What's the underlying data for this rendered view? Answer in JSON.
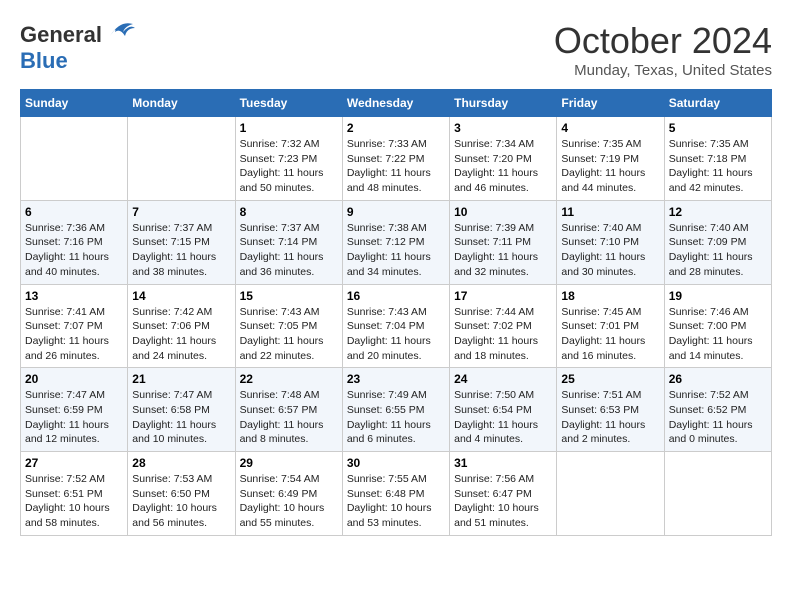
{
  "header": {
    "logo_text_general": "General",
    "logo_text_blue": "Blue",
    "month_title": "October 2024",
    "location": "Munday, Texas, United States"
  },
  "days_of_week": [
    "Sunday",
    "Monday",
    "Tuesday",
    "Wednesday",
    "Thursday",
    "Friday",
    "Saturday"
  ],
  "weeks": [
    [
      {
        "day": "",
        "content": ""
      },
      {
        "day": "",
        "content": ""
      },
      {
        "day": "1",
        "content": "Sunrise: 7:32 AM\nSunset: 7:23 PM\nDaylight: 11 hours and 50 minutes."
      },
      {
        "day": "2",
        "content": "Sunrise: 7:33 AM\nSunset: 7:22 PM\nDaylight: 11 hours and 48 minutes."
      },
      {
        "day": "3",
        "content": "Sunrise: 7:34 AM\nSunset: 7:20 PM\nDaylight: 11 hours and 46 minutes."
      },
      {
        "day": "4",
        "content": "Sunrise: 7:35 AM\nSunset: 7:19 PM\nDaylight: 11 hours and 44 minutes."
      },
      {
        "day": "5",
        "content": "Sunrise: 7:35 AM\nSunset: 7:18 PM\nDaylight: 11 hours and 42 minutes."
      }
    ],
    [
      {
        "day": "6",
        "content": "Sunrise: 7:36 AM\nSunset: 7:16 PM\nDaylight: 11 hours and 40 minutes."
      },
      {
        "day": "7",
        "content": "Sunrise: 7:37 AM\nSunset: 7:15 PM\nDaylight: 11 hours and 38 minutes."
      },
      {
        "day": "8",
        "content": "Sunrise: 7:37 AM\nSunset: 7:14 PM\nDaylight: 11 hours and 36 minutes."
      },
      {
        "day": "9",
        "content": "Sunrise: 7:38 AM\nSunset: 7:12 PM\nDaylight: 11 hours and 34 minutes."
      },
      {
        "day": "10",
        "content": "Sunrise: 7:39 AM\nSunset: 7:11 PM\nDaylight: 11 hours and 32 minutes."
      },
      {
        "day": "11",
        "content": "Sunrise: 7:40 AM\nSunset: 7:10 PM\nDaylight: 11 hours and 30 minutes."
      },
      {
        "day": "12",
        "content": "Sunrise: 7:40 AM\nSunset: 7:09 PM\nDaylight: 11 hours and 28 minutes."
      }
    ],
    [
      {
        "day": "13",
        "content": "Sunrise: 7:41 AM\nSunset: 7:07 PM\nDaylight: 11 hours and 26 minutes."
      },
      {
        "day": "14",
        "content": "Sunrise: 7:42 AM\nSunset: 7:06 PM\nDaylight: 11 hours and 24 minutes."
      },
      {
        "day": "15",
        "content": "Sunrise: 7:43 AM\nSunset: 7:05 PM\nDaylight: 11 hours and 22 minutes."
      },
      {
        "day": "16",
        "content": "Sunrise: 7:43 AM\nSunset: 7:04 PM\nDaylight: 11 hours and 20 minutes."
      },
      {
        "day": "17",
        "content": "Sunrise: 7:44 AM\nSunset: 7:02 PM\nDaylight: 11 hours and 18 minutes."
      },
      {
        "day": "18",
        "content": "Sunrise: 7:45 AM\nSunset: 7:01 PM\nDaylight: 11 hours and 16 minutes."
      },
      {
        "day": "19",
        "content": "Sunrise: 7:46 AM\nSunset: 7:00 PM\nDaylight: 11 hours and 14 minutes."
      }
    ],
    [
      {
        "day": "20",
        "content": "Sunrise: 7:47 AM\nSunset: 6:59 PM\nDaylight: 11 hours and 12 minutes."
      },
      {
        "day": "21",
        "content": "Sunrise: 7:47 AM\nSunset: 6:58 PM\nDaylight: 11 hours and 10 minutes."
      },
      {
        "day": "22",
        "content": "Sunrise: 7:48 AM\nSunset: 6:57 PM\nDaylight: 11 hours and 8 minutes."
      },
      {
        "day": "23",
        "content": "Sunrise: 7:49 AM\nSunset: 6:55 PM\nDaylight: 11 hours and 6 minutes."
      },
      {
        "day": "24",
        "content": "Sunrise: 7:50 AM\nSunset: 6:54 PM\nDaylight: 11 hours and 4 minutes."
      },
      {
        "day": "25",
        "content": "Sunrise: 7:51 AM\nSunset: 6:53 PM\nDaylight: 11 hours and 2 minutes."
      },
      {
        "day": "26",
        "content": "Sunrise: 7:52 AM\nSunset: 6:52 PM\nDaylight: 11 hours and 0 minutes."
      }
    ],
    [
      {
        "day": "27",
        "content": "Sunrise: 7:52 AM\nSunset: 6:51 PM\nDaylight: 10 hours and 58 minutes."
      },
      {
        "day": "28",
        "content": "Sunrise: 7:53 AM\nSunset: 6:50 PM\nDaylight: 10 hours and 56 minutes."
      },
      {
        "day": "29",
        "content": "Sunrise: 7:54 AM\nSunset: 6:49 PM\nDaylight: 10 hours and 55 minutes."
      },
      {
        "day": "30",
        "content": "Sunrise: 7:55 AM\nSunset: 6:48 PM\nDaylight: 10 hours and 53 minutes."
      },
      {
        "day": "31",
        "content": "Sunrise: 7:56 AM\nSunset: 6:47 PM\nDaylight: 10 hours and 51 minutes."
      },
      {
        "day": "",
        "content": ""
      },
      {
        "day": "",
        "content": ""
      }
    ]
  ]
}
